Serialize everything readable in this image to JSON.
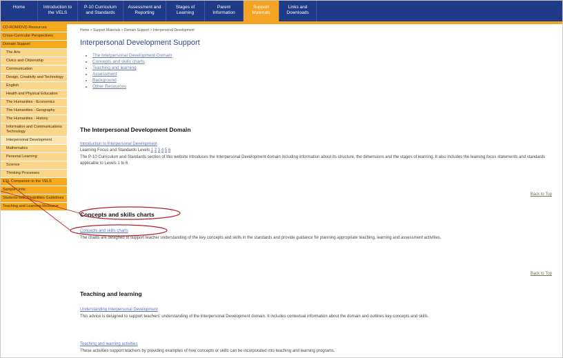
{
  "nav": {
    "tabs": [
      {
        "label": "Home"
      },
      {
        "label": "Introduction to the VELS"
      },
      {
        "label": "P-10 Curriculum and Standards"
      },
      {
        "label": "Assessment and Reporting"
      },
      {
        "label": "Stages of Learning"
      },
      {
        "label": "Parent Information"
      },
      {
        "label": "Support Materials"
      },
      {
        "label": "Links and Downloads"
      }
    ]
  },
  "sidebar": {
    "items": [
      {
        "label": "CD-ROM/DVD Resources",
        "kind": "top"
      },
      {
        "label": "Cross-Curricular Perspectives",
        "kind": "top"
      },
      {
        "label": "Domain Support",
        "kind": "top"
      },
      {
        "label": "The Arts",
        "kind": "sub"
      },
      {
        "label": "Civics and Citizenship",
        "kind": "sub"
      },
      {
        "label": "Communication",
        "kind": "sub"
      },
      {
        "label": "Design, Creativity and Technology",
        "kind": "sub"
      },
      {
        "label": "English",
        "kind": "sub"
      },
      {
        "label": "Health and Physical Education",
        "kind": "sub"
      },
      {
        "label": "The Humanities - Economics",
        "kind": "sub"
      },
      {
        "label": "The Humanities - Geography",
        "kind": "sub"
      },
      {
        "label": "The Humanities - History",
        "kind": "sub"
      },
      {
        "label": "Information and Communications Technology",
        "kind": "sub"
      },
      {
        "label": "Interpersonal Development",
        "kind": "sub active"
      },
      {
        "label": "Mathematics",
        "kind": "sub"
      },
      {
        "label": "Personal Learning",
        "kind": "sub"
      },
      {
        "label": "Science",
        "kind": "sub"
      },
      {
        "label": "Thinking Processes",
        "kind": "sub"
      },
      {
        "label": "ESL Companion to the VELS",
        "kind": "top"
      },
      {
        "label": "Sample Units",
        "kind": "top"
      },
      {
        "label": "Students with Disabilities Guidelines",
        "kind": "top"
      },
      {
        "label": "Teaching and Learning Resource",
        "kind": "top"
      }
    ]
  },
  "main": {
    "breadcrumb": "Home > Support Materials > Domain Support > Interpersonal Development",
    "title": "Interpersonal Development Support",
    "toc": [
      "The Interpersonal Development Domain",
      "Concepts and skills charts",
      "Teaching and learning",
      "Assessment",
      "Background",
      "Other Resources"
    ],
    "s1": {
      "heading": "The Interpersonal Development Domain",
      "link": "Introduction to Interpersonal Development",
      "levels_label": "Learning Focus and Standards Levels",
      "levels": [
        "1",
        "2",
        "3",
        "4",
        "5",
        "6"
      ],
      "text": "The P-10 Curriculum and Standards section of this website introduces the Interpersonal Development domain including information about its structure, the dimensions and the stages of learning. It also includes the learning focus statements and standards applicable to Levels 1 to 6."
    },
    "back_to_top": "Back to Top",
    "s2": {
      "heading": "Concepts and skills charts",
      "link": "Concepts and skills charts",
      "text": "The charts are designed to support teacher understanding of the key concepts and skills in the standards and provide guidance for planning appropriate teaching, learning and assessment activities."
    },
    "s3": {
      "heading": "Teaching and learning",
      "link1": "Understanding Interpersonal Development",
      "text1": "This advice is designed to support teachers' understanding of the Interpersonal Development domain. It includes contextual information about the domain and outlines key concepts and skills.",
      "link2": "Teaching and learning activities",
      "text2": "These activities support teachers by providing examples of how concepts or skills can be incorporated into teaching and learning programs."
    }
  },
  "colors": {
    "nav_bg": "#1f3a86",
    "accent": "#f3a423",
    "sidebar_sub": "#fbd58a",
    "annotation": "#b01e2a"
  }
}
